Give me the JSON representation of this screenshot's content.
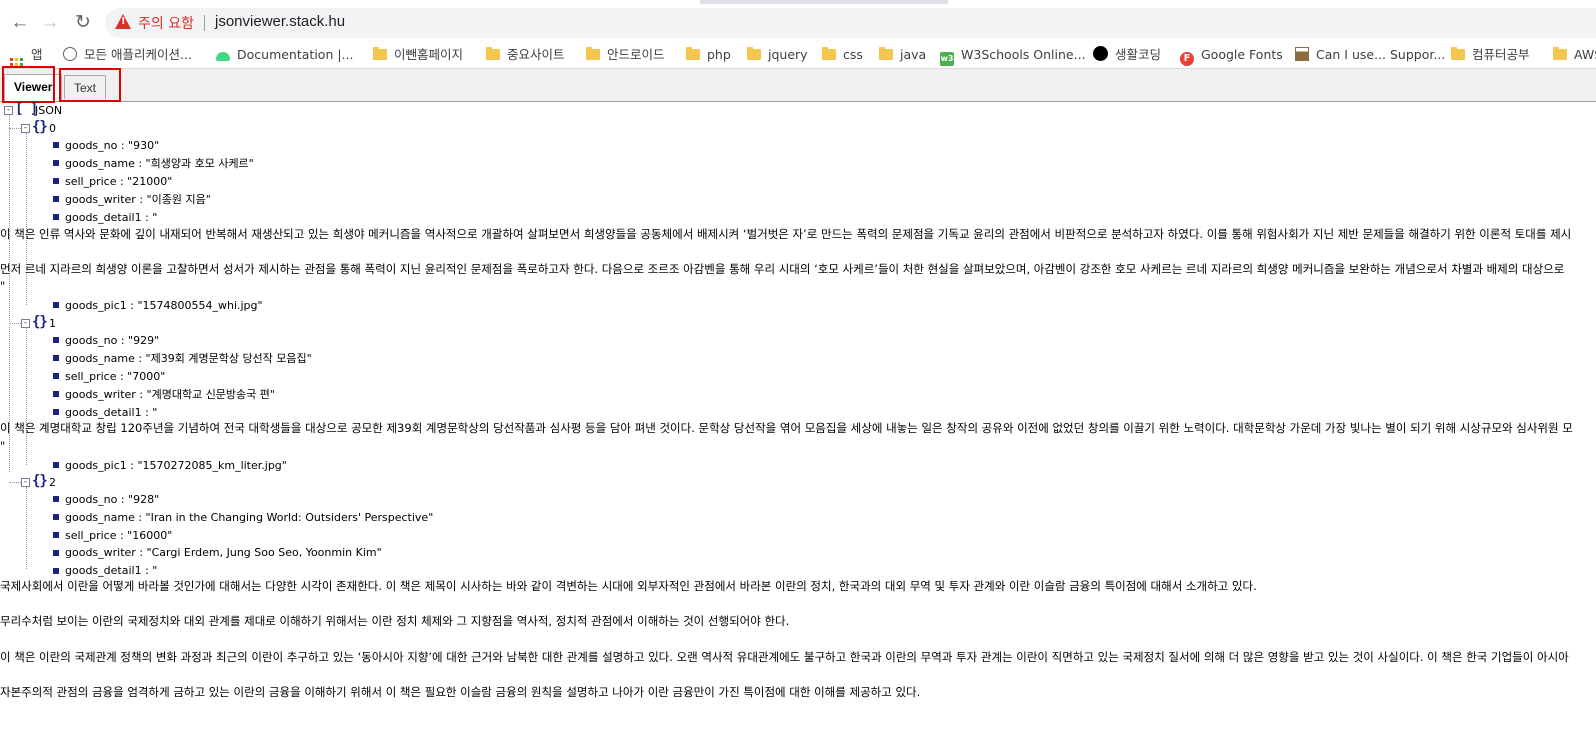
{
  "browser": {
    "warning_label": "주의 요함",
    "url": "jsonviewer.stack.hu"
  },
  "bookmarks": [
    {
      "label": "앱",
      "icon": "apps-grid-icon"
    },
    {
      "label": "모든 애플리케이션...",
      "icon": "globe-icon"
    },
    {
      "label": "Documentation  |...",
      "icon": "android-icon"
    },
    {
      "label": "이뺀홈페이지",
      "icon": "folder-icon"
    },
    {
      "label": "중요사이트",
      "icon": "folder-icon"
    },
    {
      "label": "안드로이드",
      "icon": "folder-icon"
    },
    {
      "label": "php",
      "icon": "folder-icon"
    },
    {
      "label": "jquery",
      "icon": "folder-icon"
    },
    {
      "label": "css",
      "icon": "folder-icon"
    },
    {
      "label": "java",
      "icon": "folder-icon"
    },
    {
      "label": "W3Schools Online...",
      "icon": "w3schools-icon"
    },
    {
      "label": "생활코딩",
      "icon": "black-circle-icon"
    },
    {
      "label": "Google Fonts",
      "icon": "google-fonts-icon"
    },
    {
      "label": "Can I use... Suppor...",
      "icon": "caniuse-icon"
    },
    {
      "label": "컴퓨터공부",
      "icon": "folder-icon"
    },
    {
      "label": "AWS",
      "icon": "folder-icon"
    }
  ],
  "viewer": {
    "tabs": [
      "Viewer",
      "Text"
    ],
    "active_tab": "Viewer",
    "root_label": "JSON",
    "items": [
      {
        "index": "0",
        "fields": [
          "goods_no : \"930\"",
          "goods_name : \"희생양과 호모 사케르\"",
          "sell_price : \"21000\"",
          "goods_writer : \"이종원 지음\"",
          "goods_detail1 : \""
        ],
        "detail_lines": [
          "이 책은 인류 역사와 문화에 깊이 내재되어 반복해서 재생산되고 있는 희생야 메커니즘을 역사적으로 개괄하여 살펴보면서 희생양들을 공동체에서 배제시켜 ‘벌거벗은 자’로 만드는 폭력의 문제점을 기독교 윤리의 관점에서 비판적으로 분석하고자 하였다. 이를 통해 위험사회가 지닌 제반 문제들을 해결하기 위한 이론적 토대를 제시",
          "먼저 르네 지라르의 희생양 이론을 고찰하면서 성서가 제시하는 관점을 통해 폭력이 지닌 윤리적인 문제점을 폭로하고자 한다. 다음으로 조르조 아감벤을 통해 우리 시대의 ‘호모 사케르’들이 처한 현실을 살펴보았으며, 아감벤이 강조한 호모 사케르는 르네 지라르의 희생양 메커니즘을 보완하는 개념으로서 차별과 배제의 대상으로",
          "\""
        ],
        "pic": "goods_pic1 : \"1574800554_whi.jpg\""
      },
      {
        "index": "1",
        "fields": [
          "goods_no : \"929\"",
          "goods_name : \"제39회 계명문학상 당선작 모음집\"",
          "sell_price : \"7000\"",
          "goods_writer : \"계명대학교 신문방송국 편\"",
          "goods_detail1 : \""
        ],
        "detail_lines": [
          "이 책은 계명대학교 창립 120주년을 기념하여 전국 대학생들을 대상으로 공모한 제39회 계명문학상의 당선작품과 심사평 등을 담아 펴낸 것이다. 문학상 당선작을 엮어 모음집을 세상에 내놓는 일은 창작의 공유와 이전에 없었던 창의를 이끌기 위한 노력이다. 대학문학상 가운데 가장 빛나는 별이 되기 위해 시상규모와 심사위원 모",
          "\""
        ],
        "pic": "goods_pic1 : \"1570272085_km_liter.jpg\""
      },
      {
        "index": "2",
        "fields": [
          "goods_no : \"928\"",
          "goods_name : \"Iran in the Changing World: Outsiders' Perspective\"",
          "sell_price : \"16000\"",
          "goods_writer : \"Cargi Erdem, Jung Soo Seo, Yoonmin Kim\"",
          "goods_detail1 : \""
        ],
        "detail_lines": [
          "국제사회에서 이란을 어떻게 바라볼 것인가에 대해서는 다양한 시각이 존재한다. 이 책은 제목이 시사하는 바와 같이 격변하는 시대에 외부자적인 관점에서 바라본 이란의 정치, 한국과의 대외 무역 및 투자 관계와 이란 이슬람 금융의 특이점에 대해서 소개하고 있다.",
          "무리수처럼 보이는 이란의 국제정치와 대외 관계를 제대로 이해하기 위해서는 이란 정치 체제와 그 지향점을 역사적, 정치적 관점에서 이해하는 것이 선행되어야 한다.",
          "이 책은 이란의 국제관계 정책의 변화 과정과 최근의 이란이 추구하고 있는 ‘동아시아 지향’에 대한 근거와 남북한 대한 관계를 설명하고 있다. 오랜 역사적 유대관계에도 불구하고 한국과 이란의 무역과 투자 관계는 이란이 직면하고 있는 국제정치 질서에 의해 더 많은 영향을 받고 있는 것이 사실이다. 이 책은 한국 기업들이 아시아",
          "자본주의적 관점의 금융을 엄격하게 금하고 있는 이란의 금융을 이해하기 위해서 이 책은 필요한 이슬람 금융의 원칙을 설명하고 나아가 이란 금융만이 가진 특이점에 대한 이해를 제공하고 있다."
        ]
      }
    ]
  },
  "colors": {
    "highlight_box": "#e00000",
    "tree_icon": "#1a237e",
    "warning": "#d93025"
  }
}
